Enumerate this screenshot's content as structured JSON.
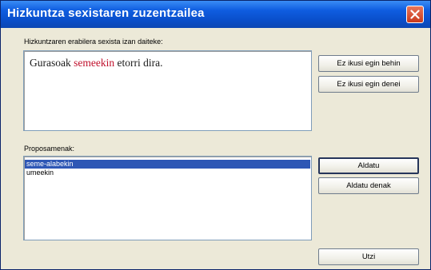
{
  "window": {
    "title": "Hizkuntza sexistaren zuzentzailea"
  },
  "context": {
    "label": "Hizkuntzaren erabilera sexista izan daiteke:",
    "sentence_before": "Gurasoak ",
    "sentence_highlight": "semeekin",
    "sentence_after": " etorri dira."
  },
  "buttons": {
    "ignore_once": "Ez ikusi egin behin",
    "ignore_always": "Ez ikusi egin denei",
    "change": "Aldatu",
    "change_all": "Aldatu denak",
    "close": "Utzi"
  },
  "suggestions": {
    "label": "Proposamenak:",
    "items": [
      "seme-alabekin",
      "umeekin"
    ],
    "selected": "seme-alabekin"
  },
  "icons": {
    "close": "close-icon"
  },
  "colors": {
    "titlebar": "#0A4FCB",
    "dialog_bg": "#ECE9D8",
    "highlight_text": "#C0102C",
    "selection": "#2E57B5",
    "close_button": "#D45034"
  }
}
